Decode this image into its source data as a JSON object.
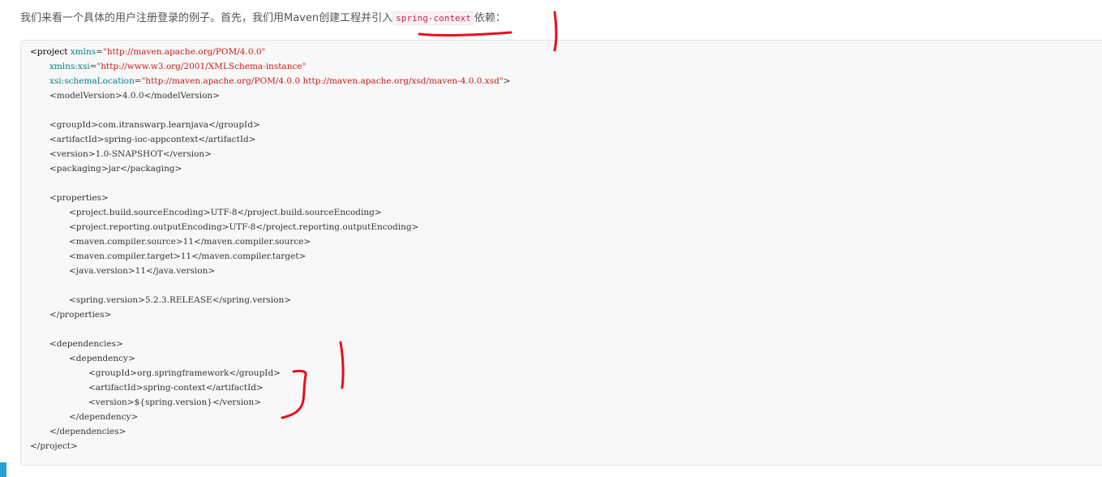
{
  "intro": {
    "before": "我们来看一个具体的用户注册登录的例子。首先，我们用Maven创建工程并引入",
    "code": "spring-context",
    "after": "依赖："
  },
  "pom": {
    "project_open": "<project",
    "xmlns_attr": "xmlns",
    "xmlns_val": "\"http://maven.apache.org/POM/4.0.0\"",
    "xsi_attr": "xmlns:xsi",
    "xsi_val": "\"http://www.w3.org/2001/XMLSchema-instance\"",
    "schema_attr": "xsi:schemaLocation",
    "schema_val": "\"http://maven.apache.org/POM/4.0.0 http://maven.apache.org/xsd/maven-4.0.0.xsd\"",
    "model_version": "<modelVersion>4.0.0</modelVersion>",
    "group_id": "<groupId>com.itranswarp.learnjava</groupId>",
    "artifact_id": "<artifactId>spring-ioc-appcontext</artifactId>",
    "version": "<version>1.0-SNAPSHOT</version>",
    "packaging": "<packaging>jar</packaging>",
    "properties_open": "<properties>",
    "prop_source_encoding": "<project.build.sourceEncoding>UTF-8</project.build.sourceEncoding>",
    "prop_output_encoding": "<project.reporting.outputEncoding>UTF-8</project.reporting.outputEncoding>",
    "prop_compiler_source": "<maven.compiler.source>11</maven.compiler.source>",
    "prop_compiler_target": "<maven.compiler.target>11</maven.compiler.target>",
    "prop_java_version": "<java.version>11</java.version>",
    "prop_spring_version": "<spring.version>5.2.3.RELEASE</spring.version>",
    "properties_close": "</properties>",
    "dependencies_open": "<dependencies>",
    "dependency_open": "<dependency>",
    "dep_group_id": "<groupId>org.springframework</groupId>",
    "dep_artifact_id": "<artifactId>spring-context</artifactId>",
    "dep_version": "<version>${spring.version}</version>",
    "dependency_close": "</dependency>",
    "dependencies_close": "</dependencies>",
    "project_close": "</project>"
  },
  "colors": {
    "annotation": "#e8101a",
    "inline_code": "#c7254e",
    "string": "#c41a16",
    "attribute": "#008080"
  }
}
